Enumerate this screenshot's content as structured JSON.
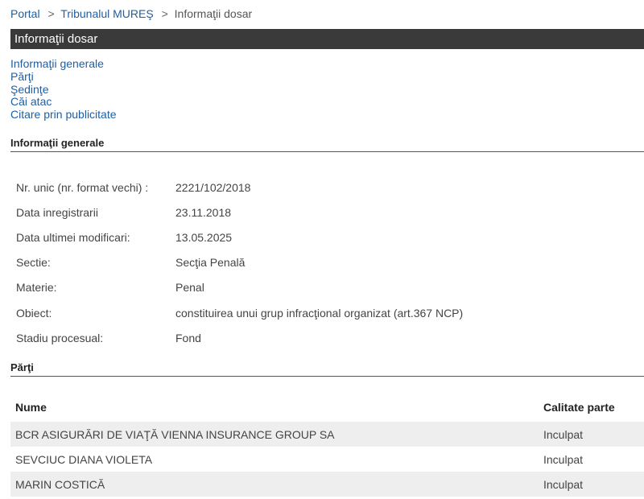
{
  "breadcrumb": {
    "items": [
      "Portal",
      "Tribunalul MUREŞ",
      "Informaţii dosar"
    ],
    "separator": ">"
  },
  "title_bar": "Informaţii dosar",
  "nav_links": [
    "Informaţii generale",
    "Părţi",
    "Şedinţe",
    "Căi atac",
    "Citare prin publicitate"
  ],
  "general": {
    "title": "Informaţii generale",
    "rows": [
      {
        "label": "Nr. unic (nr. format vechi) :",
        "value": "2221/102/2018"
      },
      {
        "label": "Data inregistrarii",
        "value": "23.11.2018"
      },
      {
        "label": "Data ultimei modificari:",
        "value": "13.05.2025"
      },
      {
        "label": "Sectie:",
        "value": "Secţia Penală"
      },
      {
        "label": "Materie:",
        "value": "Penal"
      },
      {
        "label": "Obiect:",
        "value": "constituirea unui grup infracţional organizat (art.367 NCP)"
      },
      {
        "label": "Stadiu procesual:",
        "value": "Fond"
      }
    ]
  },
  "parties": {
    "title": "Părţi",
    "headers": {
      "name": "Nume",
      "role": "Calitate parte"
    },
    "rows": [
      {
        "name": "BCR ASIGURĂRI DE VIAŢĂ VIENNA INSURANCE GROUP SA",
        "role": "Inculpat"
      },
      {
        "name": "SEVCIUC DIANA VIOLETA",
        "role": "Inculpat"
      },
      {
        "name": "MARIN COSTICĂ",
        "role": "Inculpat"
      }
    ]
  },
  "colors": {
    "link": "#1f5fa3",
    "title_bar_bg": "#3a3a3a",
    "row_alt_bg": "#eeeeee"
  }
}
